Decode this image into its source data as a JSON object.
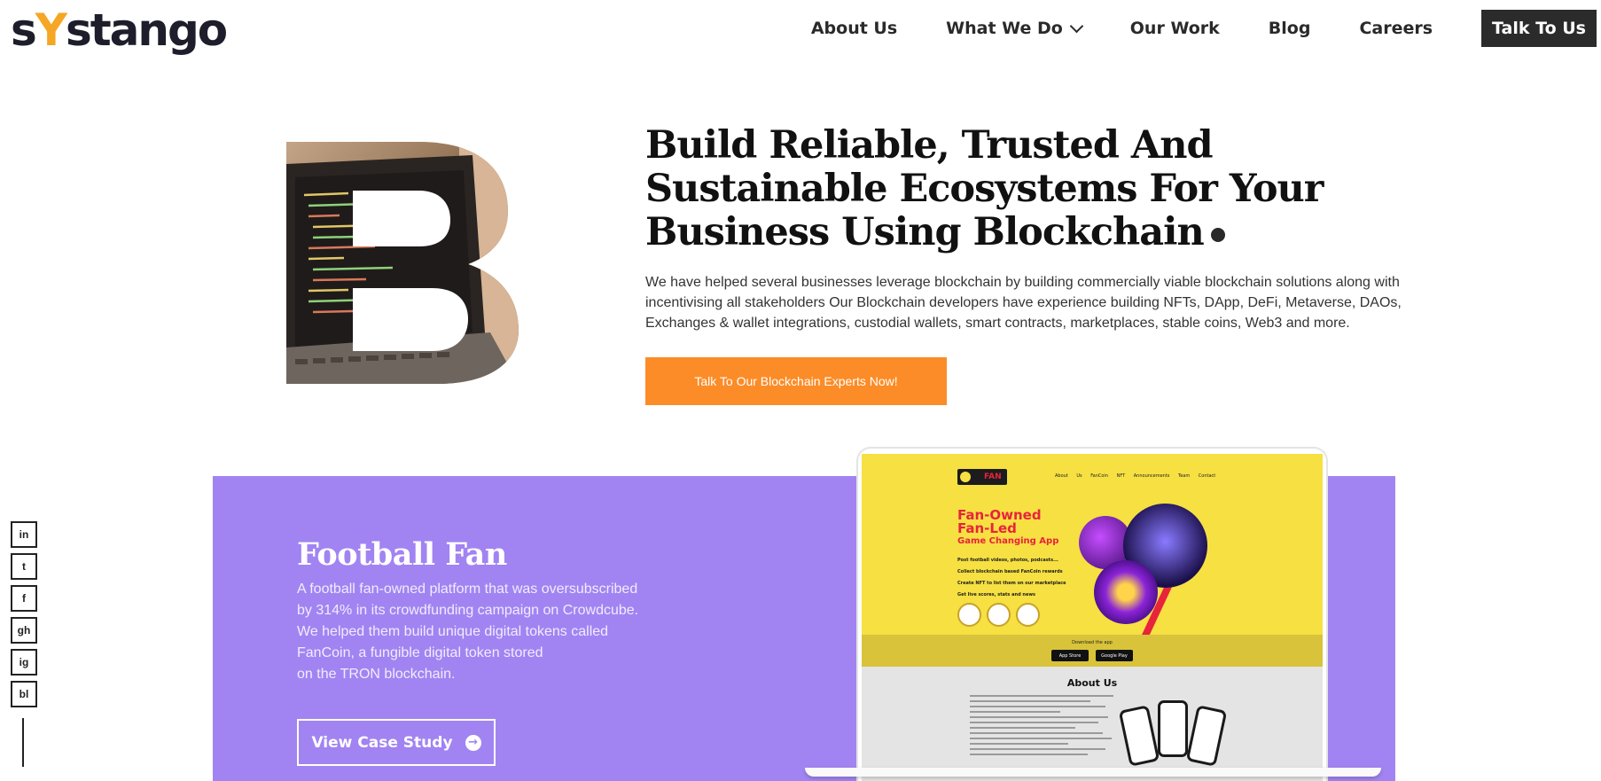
{
  "brand": {
    "logo_pre": "s",
    "logo_accent": "Y",
    "logo_post": "stango"
  },
  "nav": {
    "items": [
      "About Us",
      "What We Do",
      "Our Work",
      "Blog",
      "Careers"
    ],
    "cta": "Talk To Us"
  },
  "hero": {
    "title_lines": [
      "Build Reliable, Trusted And",
      "Sustainable Ecosystems For Your",
      "Business Using Blockchain"
    ],
    "description": "We have helped several businesses leverage blockchain by building commercially viable blockchain solutions along with incentivising all stakeholders Our Blockchain developers have experience building NFTs, DApp, DeFi, Metaverse, DAOs, Exchanges & wallet integrations, custodial wallets, smart contracts, marketplaces, stable coins, Web3 and more.",
    "cta": "Talk To Our Blockchain Experts Now!"
  },
  "social": [
    "in",
    "t",
    "f",
    "gh",
    "ig",
    "bl"
  ],
  "case_study": {
    "title": "Football Fan",
    "description_lines": [
      "A football fan-owned platform that was oversubscribed",
      "by 314% in its crowdfunding campaign on Crowdcube.",
      "We helped them build unique digital tokens called",
      "FanCoin, a fungible digital token stored",
      "on the TRON blockchain."
    ],
    "cta": "View Case Study",
    "arrow": "→"
  },
  "mockup": {
    "brand": "FAN",
    "nav": "About Us FanCoin NFT Announcements Team Contact",
    "headline_lines": [
      "Fan-Owned",
      "Fan-Led"
    ],
    "subheadline": "Game Changing App",
    "bullets": [
      "Post football videos, photos, podcasts...",
      "Collect blockchain based FanCoin rewards",
      "Create NFT to list them on our marketplace",
      "Get live scores, stats and news"
    ],
    "download_label": "Download the app",
    "app_store": "App Store",
    "google_play": "Google Play",
    "about_title": "About Us"
  },
  "colors": {
    "accent_orange": "#fb8c27",
    "case_purple": "#a184f2",
    "dark": "#2b2b2b",
    "logo_yellow": "#f5a623"
  }
}
